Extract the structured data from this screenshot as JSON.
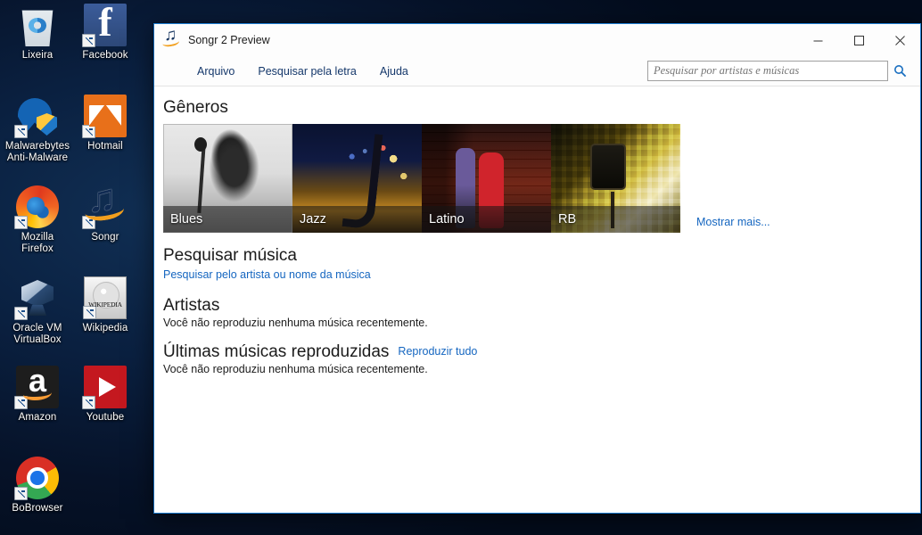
{
  "desktop": {
    "icons": [
      {
        "label": "Lixeira",
        "icon": "recycle-bin-icon",
        "shortcut": false
      },
      {
        "label": "Facebook",
        "icon": "facebook-icon",
        "shortcut": true
      },
      {
        "label": "Malwarebytes\nAnti-Malware",
        "icon": "malwarebytes-icon",
        "shortcut": true
      },
      {
        "label": "Hotmail",
        "icon": "hotmail-icon",
        "shortcut": true
      },
      {
        "label": "Mozilla\nFirefox",
        "icon": "firefox-icon",
        "shortcut": true
      },
      {
        "label": "Songr",
        "icon": "songr-icon",
        "shortcut": true
      },
      {
        "label": "Oracle VM\nVirtualBox",
        "icon": "virtualbox-icon",
        "shortcut": true
      },
      {
        "label": "Wikipedia",
        "icon": "wikipedia-icon",
        "shortcut": true
      },
      {
        "label": "Amazon",
        "icon": "amazon-icon",
        "shortcut": true
      },
      {
        "label": "Youtube",
        "icon": "youtube-icon",
        "shortcut": true
      },
      {
        "label": "BoBrowser",
        "icon": "bobrowser-icon",
        "shortcut": true
      }
    ]
  },
  "window": {
    "title": "Songr 2 Preview",
    "app_icon": "music-note-icon",
    "controls": {
      "minimize": "minimize-icon",
      "maximize": "maximize-icon",
      "close": "close-icon"
    },
    "menu": [
      {
        "label": "Arquivo"
      },
      {
        "label": "Pesquisar pela letra"
      },
      {
        "label": "Ajuda"
      }
    ],
    "search": {
      "value": "",
      "placeholder": "Pesquisar por artistas e músicas",
      "button_icon": "search-icon"
    }
  },
  "main": {
    "genres": {
      "heading": "Gêneros",
      "tiles": [
        {
          "label": "Blues"
        },
        {
          "label": "Jazz"
        },
        {
          "label": "Latino"
        },
        {
          "label": "RB"
        }
      ],
      "show_more": "Mostrar mais..."
    },
    "search_music": {
      "heading": "Pesquisar música",
      "link": "Pesquisar pelo artista ou nome da música"
    },
    "artists": {
      "heading": "Artistas",
      "empty_text": "Você não reproduziu nenhuma música recentemente."
    },
    "recent": {
      "heading": "Últimas músicas reproduzidas",
      "action": "Reproduzir tudo",
      "empty_text": "Você não reproduziu nenhuma música recentemente."
    }
  },
  "colors": {
    "accent_link": "#1566c0",
    "window_border": "#1e7fd4",
    "desktop_bg": "#0a2040",
    "menu_text": "#15386b"
  }
}
